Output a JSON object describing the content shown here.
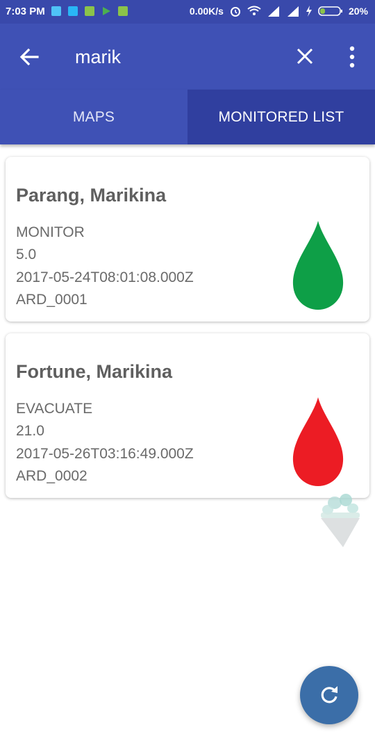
{
  "status_bar": {
    "time": "7:03 PM",
    "speed": "0.00K/s",
    "battery": "20%",
    "notification_icons": [
      "usb-icon",
      "file-icon",
      "android-icon",
      "play-store-icon",
      "android-icon"
    ]
  },
  "app_bar": {
    "search_query": "marik"
  },
  "tabs": [
    {
      "label": "MAPS"
    },
    {
      "label": "MONITORED LIST",
      "selected": true
    }
  ],
  "cards": [
    {
      "title": "Parang, Marikina",
      "status": "MONITOR",
      "value": "5.0",
      "timestamp": "2017-05-24T08:01:08.000Z",
      "device_id": "ARD_0001",
      "drop_color": "#0e9f47"
    },
    {
      "title": "Fortune, Marikina",
      "status": "EVACUATE",
      "value": "21.0",
      "timestamp": "2017-05-26T03:16:49.000Z",
      "device_id": "ARD_0002",
      "drop_color": "#ec1c24"
    }
  ],
  "colors": {
    "app_bar": "#3f51b5",
    "status_bar": "#3949ab",
    "tab_selected": "#303f9f",
    "fab": "#3b6ea8"
  },
  "fab_icon": "refresh-icon"
}
